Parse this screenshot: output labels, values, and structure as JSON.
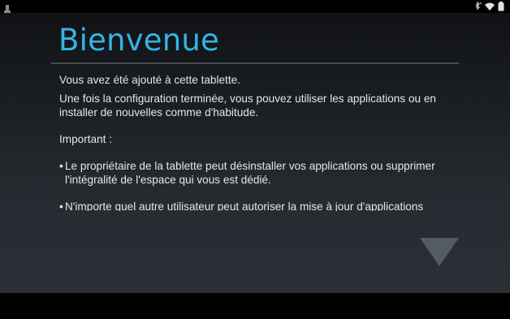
{
  "status_bar": {
    "icons": [
      "notification-icon",
      "bluetooth-icon",
      "wifi-icon",
      "battery-icon"
    ]
  },
  "welcome": {
    "title": "Bienvenue",
    "paragraph_1": "Vous avez été ajouté à cette tablette.",
    "paragraph_2": "Une fois la configuration terminée, vous pouvez utiliser les applications ou en installer de nouvelles comme d'habitude.",
    "important_label": "Important :",
    "bullets": [
      "Le propriétaire de la tablette peut désinstaller vos applications ou supprimer l'intégralité de l'espace qui vous est dédié.",
      "N'importe quel autre utilisateur peut autoriser la mise à jour d'applications"
    ],
    "bullet_marker": "•"
  },
  "colors": {
    "accent": "#33b5e5",
    "text": "#e6e6e6",
    "divider": "#4a4f55",
    "arrow": "#555b62"
  },
  "next_button": {
    "icon": "down-arrow-icon"
  }
}
